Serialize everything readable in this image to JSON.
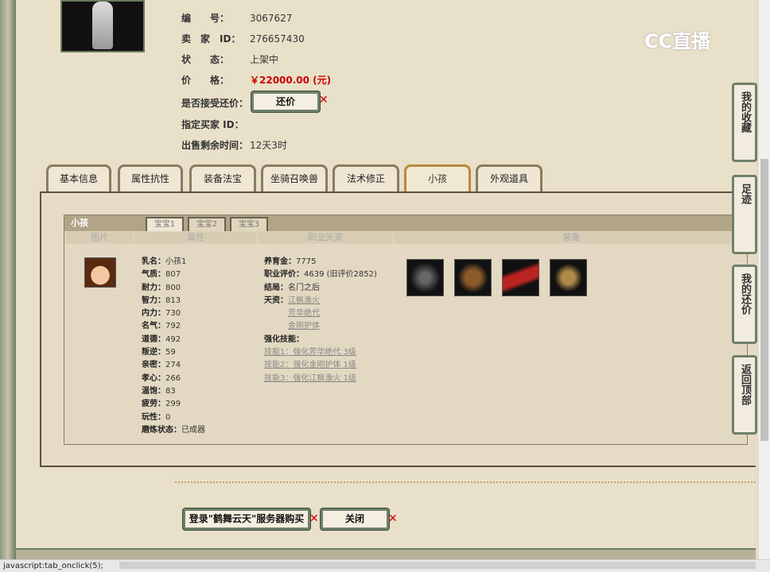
{
  "item": {
    "rows": [
      {
        "label": "编　　号：",
        "value": "3067627"
      },
      {
        "label": "卖　家　ID：",
        "value": "276657430"
      },
      {
        "label": "状　　态：",
        "value": "上架中"
      },
      {
        "label": "价　　格：",
        "value": "￥22000.00 (元)"
      },
      {
        "label": "是否接受还价：",
        "value": ""
      },
      {
        "label": "指定买家 ID：",
        "value": ""
      },
      {
        "label": "出售剩余时间：",
        "value": "12天3时"
      }
    ],
    "counter_offer_button": "还价"
  },
  "tabs": [
    "基本信息",
    "属性抗性",
    "装备法宝",
    "坐骑召唤兽",
    "法术修正",
    "小孩",
    "外观道具"
  ],
  "active_tab": "小孩",
  "child": {
    "title": "小孩",
    "subtabs": [
      "宝宝1",
      "宝宝2",
      "宝宝3"
    ],
    "active_subtab": "宝宝1",
    "columns": [
      "图片",
      "属性",
      "职业天资",
      "装备"
    ],
    "attrs": [
      [
        "乳名：",
        "小孩1"
      ],
      [
        "气质：",
        "807"
      ],
      [
        "耐力：",
        "800"
      ],
      [
        "智力：",
        "813"
      ],
      [
        "内力：",
        "730"
      ],
      [
        "名气：",
        "792"
      ],
      [
        "道德：",
        "492"
      ],
      [
        "叛逆：",
        "59"
      ],
      [
        "亲密：",
        "274"
      ],
      [
        "孝心：",
        "266"
      ],
      [
        "温饱：",
        "83"
      ],
      [
        "疲劳：",
        "299"
      ],
      [
        "玩性：",
        "0"
      ],
      [
        "磨炼状态：",
        "已成器"
      ]
    ],
    "career": {
      "fee_label": "养育金：",
      "fee": "7775",
      "rating_label": "职业评价：",
      "rating": "4639 (旧评价2852)",
      "ending_label": "结局：",
      "ending": "名门之后",
      "talent_label": "天资：",
      "talents": [
        "江枫渔火",
        "芳华绝代",
        "金刚护体"
      ],
      "skills_label": "强化技能：",
      "skills": [
        "技能1：强化芳华绝代 3级",
        "技能2：强化金刚护体 1级",
        "技能3：强化江枫渔火 1级"
      ]
    }
  },
  "footer": {
    "buy_button": "登录\"鹤舞云天\"服务器购买",
    "close_button": "关闭"
  },
  "side": [
    "我的收藏",
    "足迹",
    "我的还价",
    "返回顶部"
  ],
  "watermark": "CC直播",
  "status_bar": "javascript:tab_onclick(5);"
}
